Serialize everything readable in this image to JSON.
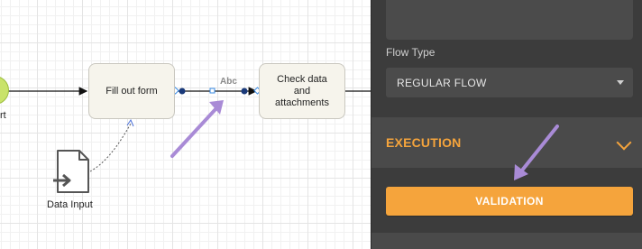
{
  "canvas": {
    "start_event_label": "rt",
    "task_fill_out_form": [
      "Fill out form"
    ],
    "task_check_data": [
      "Check data",
      "and",
      "attachments"
    ],
    "sequence_flow_label": "Abc",
    "data_input_label": "Data Input"
  },
  "panel": {
    "flow_type_label": "Flow Type",
    "flow_type_value": "REGULAR FLOW",
    "execution_section_title": "EXECUTION",
    "validation_button_label": "VALIDATION"
  },
  "colors": {
    "accent": "#f5a43c",
    "panel_bg": "#3c3c3c",
    "annotation_arrow": "#a98bd6",
    "start_event": "#c9e36a"
  },
  "icons": {
    "data_input": "document-arrow-icon",
    "chevron": "chevron-down-icon",
    "caret": "caret-down-icon"
  }
}
